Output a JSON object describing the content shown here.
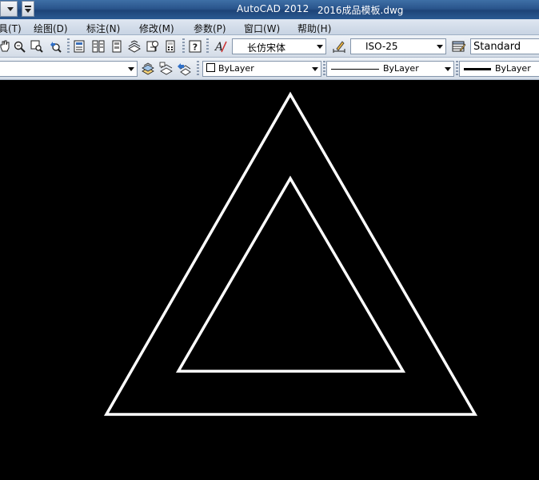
{
  "titlebar": {
    "app_title": "AutoCAD 2012",
    "doc_title": "2016成品模板.dwg"
  },
  "menubar": {
    "items": [
      "具(T)",
      "绘图(D)",
      "标注(N)",
      "修改(M)",
      "参数(P)",
      "窗口(W)",
      "帮助(H)"
    ]
  },
  "toolbar1": {
    "text_style_icon": "text-style-icon",
    "font_value": "长仿宋体",
    "dim_style_icon": "dimension-style-icon",
    "dim_style_value": "ISO-25",
    "table_style_icon": "table-style-icon",
    "table_style_value": "Standard",
    "icons": [
      "pan-icon",
      "zoom-realtime-icon",
      "zoom-window-icon",
      "zoom-previous-icon",
      "properties-icon",
      "design-center-icon",
      "tool-palettes-icon",
      "sheet-set-icon",
      "markup-icon",
      "quickcalc-icon",
      "help-icon"
    ]
  },
  "toolbar2": {
    "layer_value": "",
    "color_value": "ByLayer",
    "linetype_value": "ByLayer",
    "lineweight_value": "ByLayer",
    "icons": [
      "layer-properties-icon",
      "layer-states-icon",
      "layer-previous-icon"
    ]
  },
  "drawing": {
    "background": "#000000",
    "line_color": "#ffffff",
    "shapes": [
      "outer-triangle",
      "inner-triangle"
    ]
  }
}
